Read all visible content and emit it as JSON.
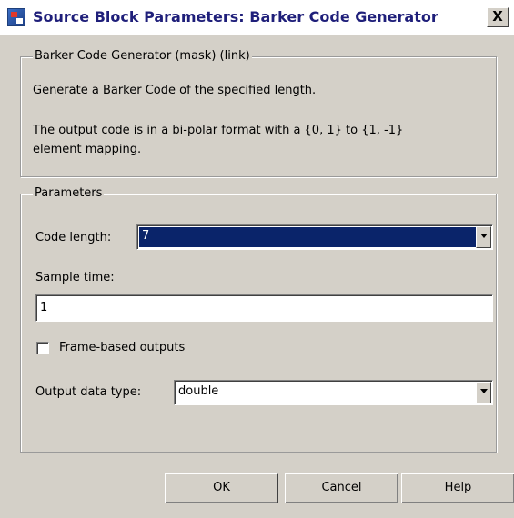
{
  "window": {
    "title": "Source Block Parameters: Barker Code Generator",
    "close_label": "X"
  },
  "description_group": {
    "legend": "Barker Code Generator (mask) (link)",
    "line1": "Generate a Barker Code of the specified length.",
    "line2": "The output code is in a bi-polar format with a {0, 1} to {1, -1}",
    "line3": "element mapping."
  },
  "parameters_group": {
    "legend": "Parameters",
    "code_length": {
      "label": "Code length:",
      "value": "7"
    },
    "sample_time": {
      "label": "Sample time:",
      "value": "1"
    },
    "frame_based": {
      "label": "Frame-based outputs",
      "checked": false
    },
    "output_type": {
      "label": "Output data type:",
      "value": "double"
    }
  },
  "buttons": {
    "ok": "OK",
    "cancel": "Cancel",
    "help": "Help"
  }
}
